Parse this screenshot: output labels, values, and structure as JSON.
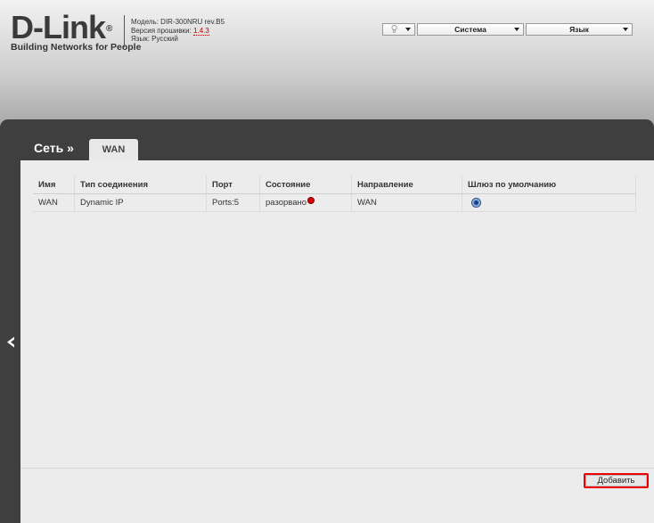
{
  "logo": {
    "name": "D-Link",
    "registered": "®",
    "tagline": "Building Networks for People"
  },
  "device_info": {
    "model": "Модель: DIR-300NRU rev.B5",
    "firmware_label": "Версия прошивки: ",
    "firmware_version": "1.4.3",
    "language": "Язык: Русский"
  },
  "controls": {
    "hint_icon": "bulb-icon",
    "system_label": "Система",
    "language_label": "Язык"
  },
  "breadcrumb": {
    "section": "Сеть »",
    "tab": "WAN"
  },
  "table": {
    "headers": [
      "Имя",
      "Тип соединения",
      "Порт",
      "Состояние",
      "Направление",
      "Шлюз по умолчанию"
    ],
    "rows": [
      {
        "name": "WAN",
        "type": "Dynamic IP",
        "port": "Ports:5",
        "state": "разорвано",
        "direction": "WAN",
        "default_gateway": true
      }
    ]
  },
  "actions": {
    "add_label": "Добавить"
  },
  "colors": {
    "status_disconnected": "#dd0000",
    "highlight": "#ee0000",
    "panel": "#3f3f3f"
  }
}
